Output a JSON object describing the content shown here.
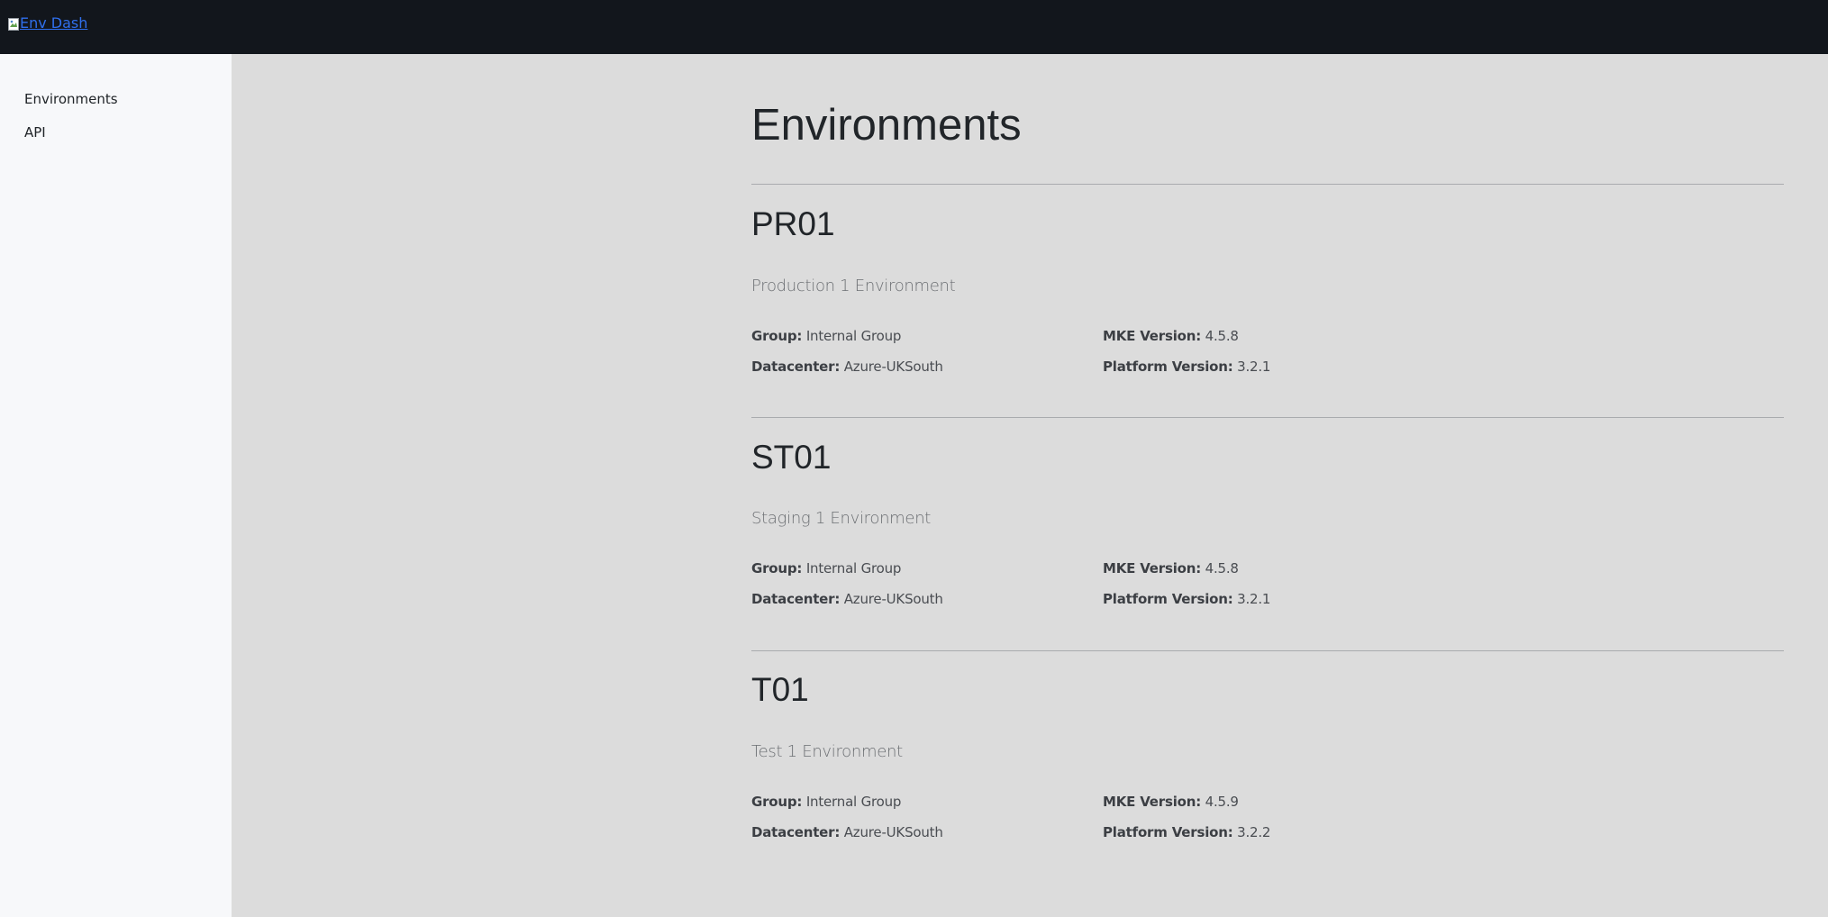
{
  "header": {
    "brand_alt": "Env Dash"
  },
  "sidebar": {
    "items": [
      {
        "label": "Environments"
      },
      {
        "label": "API"
      }
    ]
  },
  "main": {
    "title": "Environments",
    "environments": [
      {
        "name": "PR01",
        "description": "Production 1 Environment",
        "group_label": "Group:",
        "group": "Internal Group",
        "datacenter_label": "Datacenter:",
        "datacenter": "Azure-UKSouth",
        "mke_label": "MKE Version:",
        "mke_version": "4.5.8",
        "platform_label": "Platform Version:",
        "platform_version": "3.2.1"
      },
      {
        "name": "ST01",
        "description": "Staging 1 Environment",
        "group_label": "Group:",
        "group": "Internal Group",
        "datacenter_label": "Datacenter:",
        "datacenter": "Azure-UKSouth",
        "mke_label": "MKE Version:",
        "mke_version": "4.5.8",
        "platform_label": "Platform Version:",
        "platform_version": "3.2.1"
      },
      {
        "name": "T01",
        "description": "Test 1 Environment",
        "group_label": "Group:",
        "group": "Internal Group",
        "datacenter_label": "Datacenter:",
        "datacenter": "Azure-UKSouth",
        "mke_label": "MKE Version:",
        "mke_version": "4.5.9",
        "platform_label": "Platform Version:",
        "platform_version": "3.2.2"
      }
    ]
  }
}
